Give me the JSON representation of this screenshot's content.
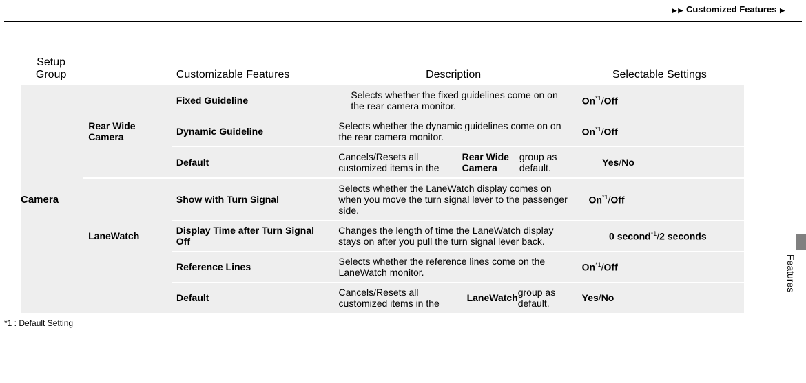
{
  "breadcrumb": "Customized Features",
  "headers": {
    "setup": "Setup Group",
    "feat": "Customizable Features",
    "desc": "Description",
    "sel": "Selectable Settings"
  },
  "setup_group": "Camera",
  "subgroups": {
    "rwc": "Rear Wide Camera",
    "lw": "LaneWatch"
  },
  "rows": {
    "r1": {
      "feat": "Fixed Guideline",
      "desc": "Selects whether the fixed guidelines come on on the rear camera monitor.",
      "sel_a": "On",
      "sel_b": "Off",
      "sup": "*1"
    },
    "r2": {
      "feat": "Dynamic Guideline",
      "desc": "Selects whether the dynamic guidelines come on on the rear camera monitor.",
      "sel_a": "On",
      "sel_b": "Off",
      "sup": "*1"
    },
    "r3": {
      "feat": "Default",
      "desc_a": "Cancels/Resets all customized items in the ",
      "desc_b": "Rear Wide Camera",
      "desc_c": " group as default.",
      "sel_a": "Yes",
      "sel_b": "No"
    },
    "r4": {
      "feat": "Show with Turn Signal",
      "desc": "Selects whether the LaneWatch display comes on when you move the turn signal lever to the passenger side.",
      "sel_a": "On",
      "sel_b": "Off",
      "sup": "*1"
    },
    "r5": {
      "feat": "Display Time after Turn Signal Off",
      "desc": "Changes the length of time the LaneWatch display stays on after you pull the turn signal lever back.",
      "sel_a": "0 second",
      "sel_b": "2 seconds",
      "sup": "*1"
    },
    "r6": {
      "feat": "Reference Lines",
      "desc": "Selects whether the reference lines come on the LaneWatch monitor.",
      "sel_a": "On",
      "sel_b": "Off",
      "sup": "*1"
    },
    "r7": {
      "feat": "Default",
      "desc_a": "Cancels/Resets all customized items in the ",
      "desc_b": "LaneWatch",
      "desc_c": " group as default.",
      "sel_a": "Yes",
      "sel_b": "No"
    }
  },
  "side_tab": "Features",
  "footnote": "*1 : Default Setting"
}
